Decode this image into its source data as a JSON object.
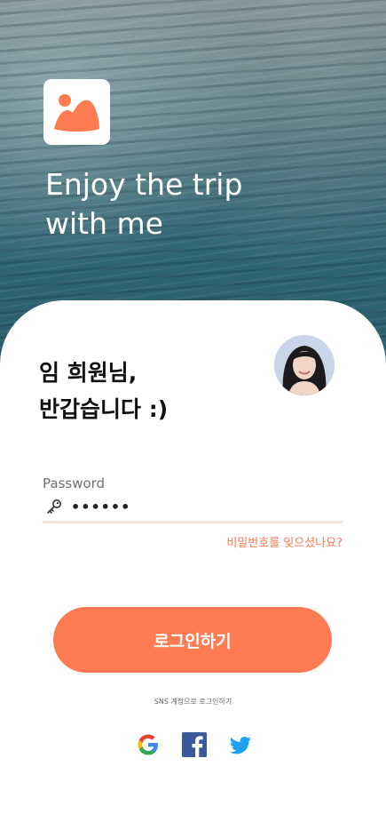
{
  "hero": {
    "tagline_line1": "Enjoy the trip",
    "tagline_line2": "with me",
    "logo_icon": "mountain-sun-icon",
    "accent_color": "#ff7b52"
  },
  "greeting": {
    "line1": "임 희원님,",
    "line2": "반갑습니다 :)"
  },
  "password": {
    "label": "Password",
    "value": "••••••",
    "icon": "key-icon"
  },
  "forgot_link": "비밀번호를 잊으셨나요?",
  "login_button": "로그인하기",
  "sns": {
    "caption": "SNS 계정으로 로그인하기",
    "providers": [
      "google-icon",
      "facebook-icon",
      "twitter-icon"
    ]
  }
}
